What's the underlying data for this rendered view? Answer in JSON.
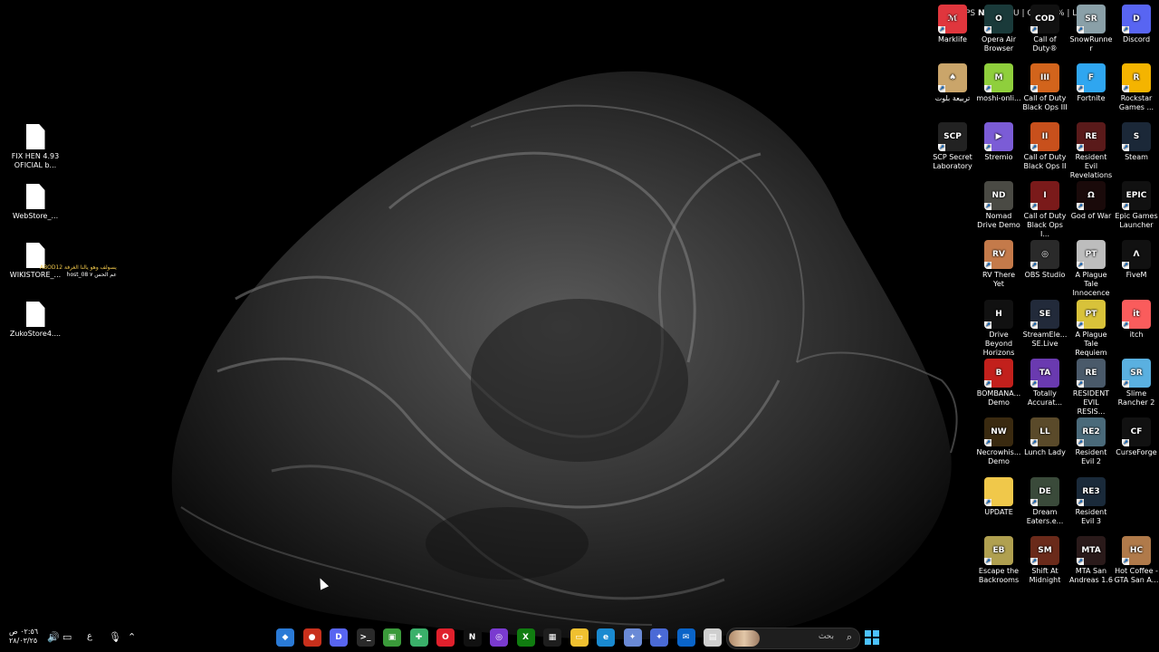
{
  "performance_overlay": {
    "fps_label": "PS",
    "fps_value": "N/A",
    "gpu_label": "| GPU",
    "cpu_label": "| CPU 34%",
    "latency_label": "| LAT",
    "latency_value": "NA"
  },
  "left_files": [
    {
      "label": "FIX HEN 4.93 OFICIAL b..."
    },
    {
      "label": "WebStore_..."
    },
    {
      "label": "WIKISTORE_..."
    },
    {
      "label": "ZukoStore4...."
    }
  ],
  "left_overlay": {
    "line1": "يسولف وهو يالنا الغرفة ABOD12",
    "line2": "عم الحس ٧ host_08"
  },
  "desktop_icons": [
    {
      "label": "Marklife",
      "color": "#e0363d",
      "glyph": "ℳ"
    },
    {
      "label": "Opera Air Browser",
      "color": "#1a3a3a",
      "glyph": "O"
    },
    {
      "label": "Call of Duty®",
      "color": "#111111",
      "glyph": "COD"
    },
    {
      "label": "SnowRunner",
      "color": "#8aa0a8",
      "glyph": "SR"
    },
    {
      "label": "Discord",
      "color": "#5865f2",
      "glyph": "D"
    },
    {
      "label": "تربيعة بلوت",
      "color": "#caa56a",
      "glyph": "♠"
    },
    {
      "label": "moshi-onli...",
      "color": "#8fcf3c",
      "glyph": "M"
    },
    {
      "label": "Call of Duty Black Ops III",
      "color": "#d2641c",
      "glyph": "III"
    },
    {
      "label": "Fortnite",
      "color": "#2fa6f0",
      "glyph": "F"
    },
    {
      "label": "Rockstar Games ...",
      "color": "#f4b400",
      "glyph": "R"
    },
    {
      "label": "SCP Secret Laboratory",
      "color": "#222222",
      "glyph": "SCP"
    },
    {
      "label": "Stremio",
      "color": "#7b5cd6",
      "glyph": "▶"
    },
    {
      "label": "Call of Duty Black Ops II",
      "color": "#c8501c",
      "glyph": "II"
    },
    {
      "label": "Resident Evil Revelations 2",
      "color": "#5a1a1a",
      "glyph": "RE"
    },
    {
      "label": "Steam",
      "color": "#1b2838",
      "glyph": "S"
    },
    {
      "label": "Nomad Drive Demo",
      "color": "#4a4a44",
      "glyph": "ND"
    },
    {
      "label": "Call of Duty Black Ops I...",
      "color": "#7a1a1a",
      "glyph": "I"
    },
    {
      "label": "God of War",
      "color": "#1a0a0a",
      "glyph": "Ω"
    },
    {
      "label": "Epic Games Launcher",
      "color": "#111111",
      "glyph": "EPIC"
    },
    {
      "label": "RV There Yet",
      "color": "#c47a4a",
      "glyph": "RV"
    },
    {
      "label": "OBS Studio",
      "color": "#2a2a2a",
      "glyph": "◎"
    },
    {
      "label": "A Plague Tale Innocence",
      "color": "#bdbdbd",
      "glyph": "PT"
    },
    {
      "label": "FiveM",
      "color": "#111111",
      "glyph": "Λ"
    },
    {
      "label": "Drive Beyond Horizons",
      "color": "#111111",
      "glyph": "H"
    },
    {
      "label": "StreamEle... SE.Live",
      "color": "#222a3a",
      "glyph": "SE"
    },
    {
      "label": "A Plague Tale Requiem",
      "color": "#d8c23a",
      "glyph": "PT"
    },
    {
      "label": "itch",
      "color": "#fa5c5c",
      "glyph": "it"
    },
    {
      "label": "BOMBANA... Demo",
      "color": "#c2201c",
      "glyph": "B"
    },
    {
      "label": "Totally Accurat...",
      "color": "#6a3ab0",
      "glyph": "TA"
    },
    {
      "label": "RESIDENT EVIL RESIS...",
      "color": "#4a5a6a",
      "glyph": "RE"
    },
    {
      "label": "Slime Rancher 2",
      "color": "#5ab0e0",
      "glyph": "SR"
    },
    {
      "label": "Necrowhis... Demo",
      "color": "#3a2a10",
      "glyph": "NW"
    },
    {
      "label": "Lunch Lady",
      "color": "#5a4a2a",
      "glyph": "LL"
    },
    {
      "label": "Resident Evil 2",
      "color": "#4a6a7a",
      "glyph": "RE2"
    },
    {
      "label": "CurseForge",
      "color": "#111111",
      "glyph": "CF"
    },
    {
      "label": "UPDATE",
      "color": "#f0c84a",
      "glyph": ""
    },
    {
      "label": "Dream Eaters.e...",
      "color": "#3a4a3a",
      "glyph": "DE"
    },
    {
      "label": "Resident Evil 3",
      "color": "#1a2a3a",
      "glyph": "RE3"
    },
    {
      "label": "Escape the Backrooms",
      "color": "#b0a050",
      "glyph": "EB"
    },
    {
      "label": "Shift At Midnight",
      "color": "#6a2a1a",
      "glyph": "SM"
    },
    {
      "label": "MTA San Andreas 1.6",
      "color": "#2a1a1a",
      "glyph": "MTA"
    },
    {
      "label": "Hot Coffee - GTA San A...",
      "color": "#b07a4a",
      "glyph": "HC"
    }
  ],
  "taskbar": {
    "search_placeholder": "بحث",
    "clock_time": "٠٢:٥٦ ص",
    "clock_date": "٢٨/٠٣/٢٥",
    "language_indicator": "ع",
    "apps": [
      {
        "name": "shield-app",
        "color": "#2a7ad6",
        "glyph": "◆"
      },
      {
        "name": "game-app",
        "color": "#c8301c",
        "glyph": "●"
      },
      {
        "name": "discord-app",
        "color": "#5865f2",
        "glyph": "D"
      },
      {
        "name": "terminal-app",
        "color": "#2a2a2a",
        "glyph": ">_"
      },
      {
        "name": "minecraft-app",
        "color": "#3a9a3a",
        "glyph": "▣"
      },
      {
        "name": "puzzle-app",
        "color": "#3ab06a",
        "glyph": "✚"
      },
      {
        "name": "opera-app",
        "color": "#e0202c",
        "glyph": "O"
      },
      {
        "name": "netflix-app",
        "color": "#111111",
        "glyph": "N"
      },
      {
        "name": "capture-app",
        "color": "#7a3ad0",
        "glyph": "◎"
      },
      {
        "name": "xbox-app",
        "color": "#107c10",
        "glyph": "X"
      },
      {
        "name": "store-app",
        "color": "#1e1e1e",
        "glyph": "▦"
      },
      {
        "name": "explorer-app",
        "color": "#f0c030",
        "glyph": "▭"
      },
      {
        "name": "edge-app",
        "color": "#1a8ad0",
        "glyph": "e"
      },
      {
        "name": "copilot-app",
        "color": "#6a8ad6",
        "glyph": "✦"
      },
      {
        "name": "copilot2-app",
        "color": "#4a6ad6",
        "glyph": "✦"
      },
      {
        "name": "outlook-app",
        "color": "#0a64c8",
        "glyph": "✉"
      },
      {
        "name": "notepad-app",
        "color": "#cfcfcf",
        "glyph": "▤"
      }
    ]
  }
}
